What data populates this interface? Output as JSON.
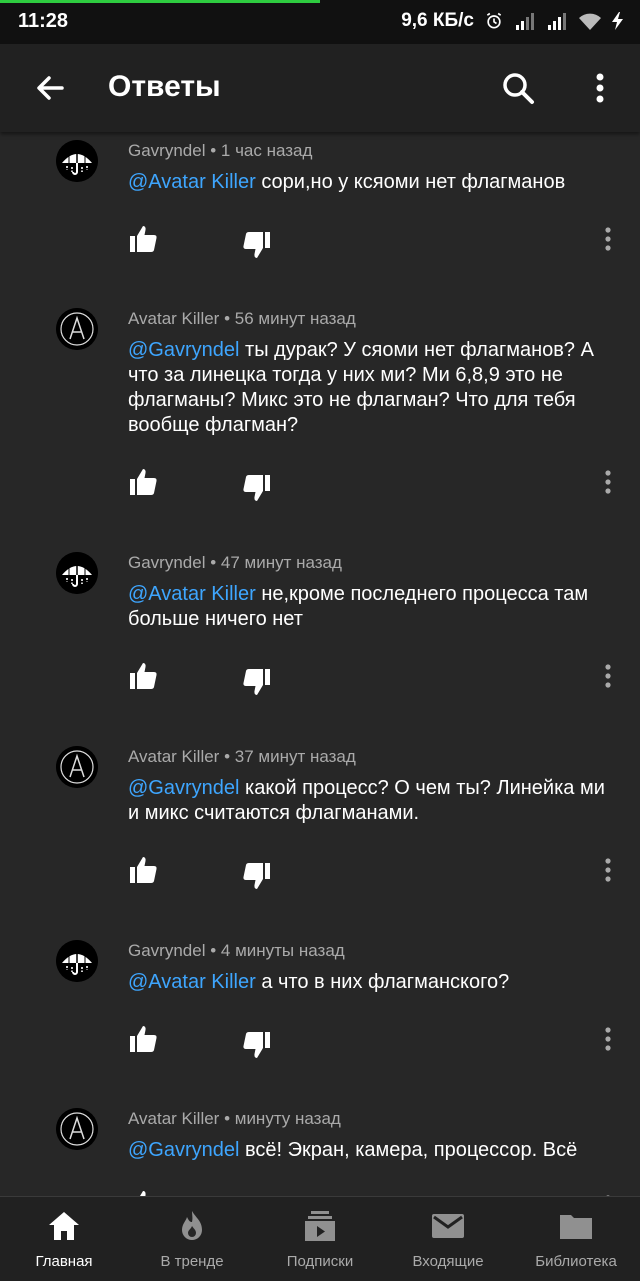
{
  "status": {
    "time": "11:28",
    "speed": "9,6 КБ/с",
    "icons": [
      "alarm-icon",
      "signal-icon",
      "signal-icon",
      "wifi-icon",
      "charging-icon"
    ]
  },
  "header": {
    "title": "Ответы",
    "back_icon": "arrow-back-icon",
    "search_icon": "search-icon",
    "menu_icon": "more-vert-icon"
  },
  "comments": [
    {
      "author": "Gavryndel",
      "time": "1 час назад",
      "mention": "@Avatar Killer",
      "text": "сори,но у ксяоми нет флагманов",
      "avatar": "umbrella"
    },
    {
      "author": "Avatar Killer",
      "time": "56 минут назад",
      "mention": "@Gavryndel",
      "text": "ты дурак? У сяоми нет флагманов? А что за линецка тогда у них ми? Ми 6,8,9 это не флагманы? Микс это не флагман? Что для тебя вообще флагман?",
      "avatar": "letter-a"
    },
    {
      "author": "Gavryndel",
      "time": "47 минут назад",
      "mention": "@Avatar Killer",
      "text": "не,кроме последнего процесса там больше ничего нет",
      "avatar": "umbrella"
    },
    {
      "author": "Avatar Killer",
      "time": "37 минут назад",
      "mention": "@Gavryndel",
      "text": "какой процесс? О чем ты? Линейка ми и микс считаются флагманами.",
      "avatar": "letter-a"
    },
    {
      "author": "Gavryndel",
      "time": "4 минуты назад",
      "mention": "@Avatar Killer",
      "text": "а что в них флагманского?",
      "avatar": "umbrella"
    },
    {
      "author": "Avatar Killer",
      "time": "минуту назад",
      "mention": "@Gavryndel",
      "text": "всё! Экран, камера, процессор. Всё",
      "avatar": "letter-a"
    }
  ],
  "meta_separator": " • ",
  "nav": [
    {
      "label": "Главная",
      "icon": "home-icon",
      "active": true
    },
    {
      "label": "В тренде",
      "icon": "trending-flame-icon",
      "active": false
    },
    {
      "label": "Подписки",
      "icon": "subscriptions-icon",
      "active": false
    },
    {
      "label": "Входящие",
      "icon": "inbox-mail-icon",
      "active": false
    },
    {
      "label": "Библиотека",
      "icon": "library-folder-icon",
      "active": false
    }
  ],
  "colors": {
    "background": "#272727",
    "appbar": "#212121",
    "mention": "#3ea6ff",
    "meta_text": "#aaaaaa",
    "status_progress": "#2ecc40"
  }
}
